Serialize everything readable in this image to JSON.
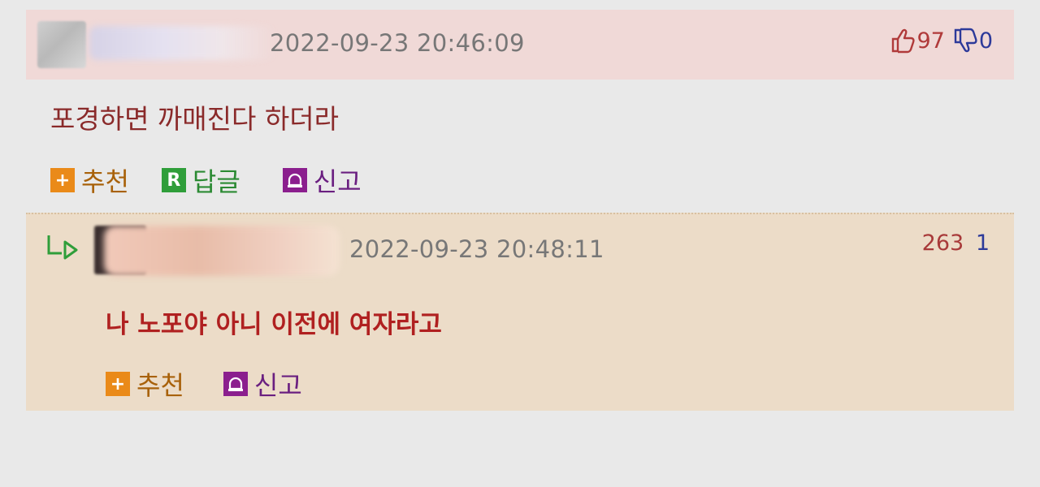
{
  "comment": {
    "timestamp": "2022-09-23 20:46:09",
    "upvotes": "97",
    "downvotes": "0",
    "text": "포경하면 까매진다 하더라",
    "actions": {
      "recommend": "추천",
      "reply": "답글",
      "report": "신고",
      "reply_badge": "R",
      "plus_badge": "+"
    }
  },
  "reply": {
    "timestamp": "2022-09-23 20:48:11",
    "upvotes": "263",
    "downvotes": "1",
    "text": "나 노포야 아니 이전에 여자라고",
    "actions": {
      "recommend": "추천",
      "report": "신고",
      "plus_badge": "+"
    }
  },
  "colors": {
    "comment_bg": "#f0d9d7",
    "reply_bg": "#ecdcc8",
    "up_color": "#b03a3a",
    "down_color": "#2d3a9a"
  }
}
